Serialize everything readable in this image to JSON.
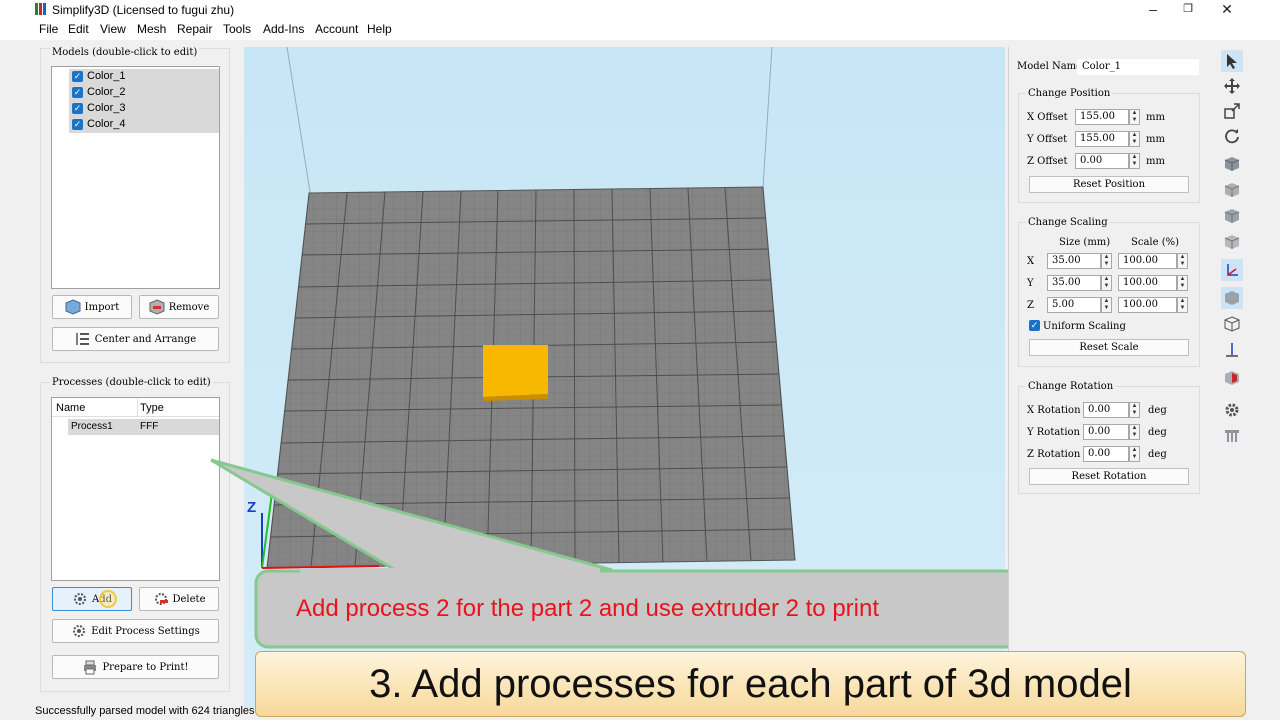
{
  "window": {
    "title": "Simplify3D (Licensed to fugui zhu)"
  },
  "menu": [
    "File",
    "Edit",
    "View",
    "Mesh",
    "Repair",
    "Tools",
    "Add-Ins",
    "Account",
    "Help"
  ],
  "models": {
    "label": "Models (double-click to edit)",
    "items": [
      "Color_1",
      "Color_2",
      "Color_3",
      "Color_4"
    ],
    "import_label": "Import",
    "remove_label": "Remove",
    "center_label": "Center and Arrange"
  },
  "processes": {
    "label": "Processes (double-click to edit)",
    "col_name": "Name",
    "col_type": "Type",
    "rows": [
      {
        "name": "Process1",
        "type": "FFF"
      }
    ],
    "add_label": "Add",
    "delete_label": "Delete",
    "edit_label": "Edit Process Settings",
    "prepare_label": "Prepare to Print!"
  },
  "viewport": {
    "axis_z": "Z"
  },
  "properties": {
    "model_name_label": "Model Name:",
    "model_name": "Color_1",
    "position": {
      "title": "Change Position",
      "x_label": "X Offset",
      "x": "155.00",
      "y_label": "Y Offset",
      "y": "155.00",
      "z_label": "Z Offset",
      "z": "0.00",
      "unit": "mm",
      "reset": "Reset Position"
    },
    "scaling": {
      "title": "Change Scaling",
      "size_header": "Size (mm)",
      "scale_header": "Scale (%)",
      "x_label": "X",
      "x_size": "35.00",
      "x_scale": "100.00",
      "y_label": "Y",
      "y_size": "35.00",
      "y_scale": "100.00",
      "z_label": "Z",
      "z_size": "5.00",
      "z_scale": "100.00",
      "uniform_label": "Uniform Scaling",
      "reset": "Reset Scale"
    },
    "rotation": {
      "title": "Change Rotation",
      "x_label": "X Rotation",
      "x": "0.00",
      "y_label": "Y Rotation",
      "y": "0.00",
      "z_label": "Z Rotation",
      "z": "0.00",
      "unit": "deg",
      "reset": "Reset Rotation"
    }
  },
  "status": "Successfully parsed model with 624 triangles",
  "callout": "Add process 2 for the part 2 and use extruder 2 to print",
  "banner": "3. Add processes for each part of 3d model",
  "colors": {
    "part": "#f8b800",
    "bed": "#858585",
    "callout_text": "#e8141c",
    "accent": "#1a73c8"
  }
}
